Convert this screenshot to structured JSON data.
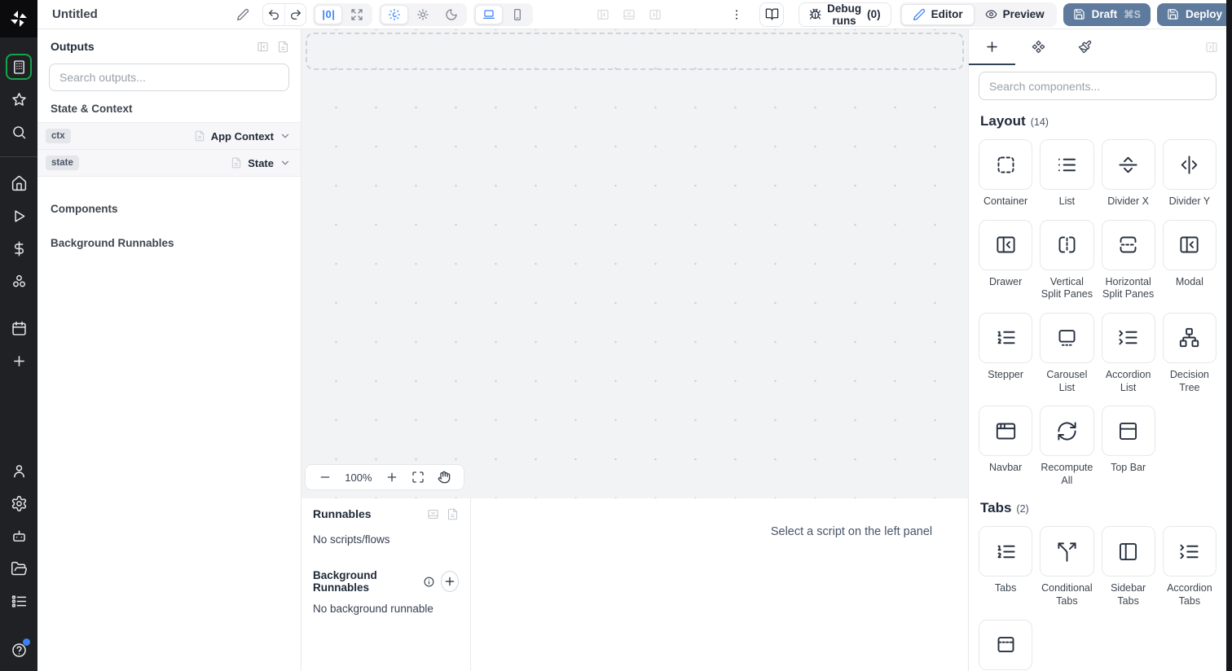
{
  "topbar": {
    "title": "Untitled",
    "zoom_reset": "|0|",
    "debug_runs": "Debug runs",
    "debug_count": "(0)",
    "editor": "Editor",
    "preview": "Preview",
    "draft": "Draft",
    "draft_shortcut": "⌘S",
    "deploy": "Deploy"
  },
  "outputs": {
    "title": "Outputs",
    "search_placeholder": "Search outputs...",
    "state_context_header": "State & Context",
    "components_header": "Components",
    "background_header": "Background Runnables",
    "rows": [
      {
        "badge": "ctx",
        "label": "App Context"
      },
      {
        "badge": "state",
        "label": "State"
      }
    ]
  },
  "canvas": {
    "zoom": "100%"
  },
  "runnables": {
    "title": "Runnables",
    "empty": "No scripts/flows",
    "background_title": "Background Runnables",
    "background_empty": "No background runnable",
    "hint": "Select a script on the left panel"
  },
  "components": {
    "search_placeholder": "Search components...",
    "sections": [
      {
        "title": "Layout",
        "count": "(14)",
        "items": [
          {
            "label": "Container",
            "icon": "container"
          },
          {
            "label": "List",
            "icon": "list"
          },
          {
            "label": "Divider X",
            "icon": "divider-x"
          },
          {
            "label": "Divider Y",
            "icon": "divider-y"
          },
          {
            "label": "Drawer",
            "icon": "drawer"
          },
          {
            "label": "Vertical Split Panes",
            "icon": "vertical-split"
          },
          {
            "label": "Horizontal Split Panes",
            "icon": "horizontal-split"
          },
          {
            "label": "Modal",
            "icon": "modal"
          },
          {
            "label": "Stepper",
            "icon": "stepper"
          },
          {
            "label": "Carousel List",
            "icon": "carousel"
          },
          {
            "label": "Accordion List",
            "icon": "accordion"
          },
          {
            "label": "Decision Tree",
            "icon": "decision-tree"
          },
          {
            "label": "Navbar",
            "icon": "navbar"
          },
          {
            "label": "Recompute All",
            "icon": "recompute"
          },
          {
            "label": "Top Bar",
            "icon": "top-bar"
          }
        ]
      },
      {
        "title": "Tabs",
        "count": "(2)",
        "items": [
          {
            "label": "Tabs",
            "icon": "tabs"
          },
          {
            "label": "Conditional Tabs",
            "icon": "conditional-tabs"
          },
          {
            "label": "Sidebar Tabs",
            "icon": "sidebar-tabs"
          },
          {
            "label": "Accordion Tabs",
            "icon": "accordion"
          },
          {
            "label": "",
            "icon": "invisible-tabs"
          }
        ]
      }
    ]
  },
  "colors": {
    "accent": "#3b82f6",
    "active_green": "#16a34a",
    "primary_button": "#5e7b9e"
  }
}
